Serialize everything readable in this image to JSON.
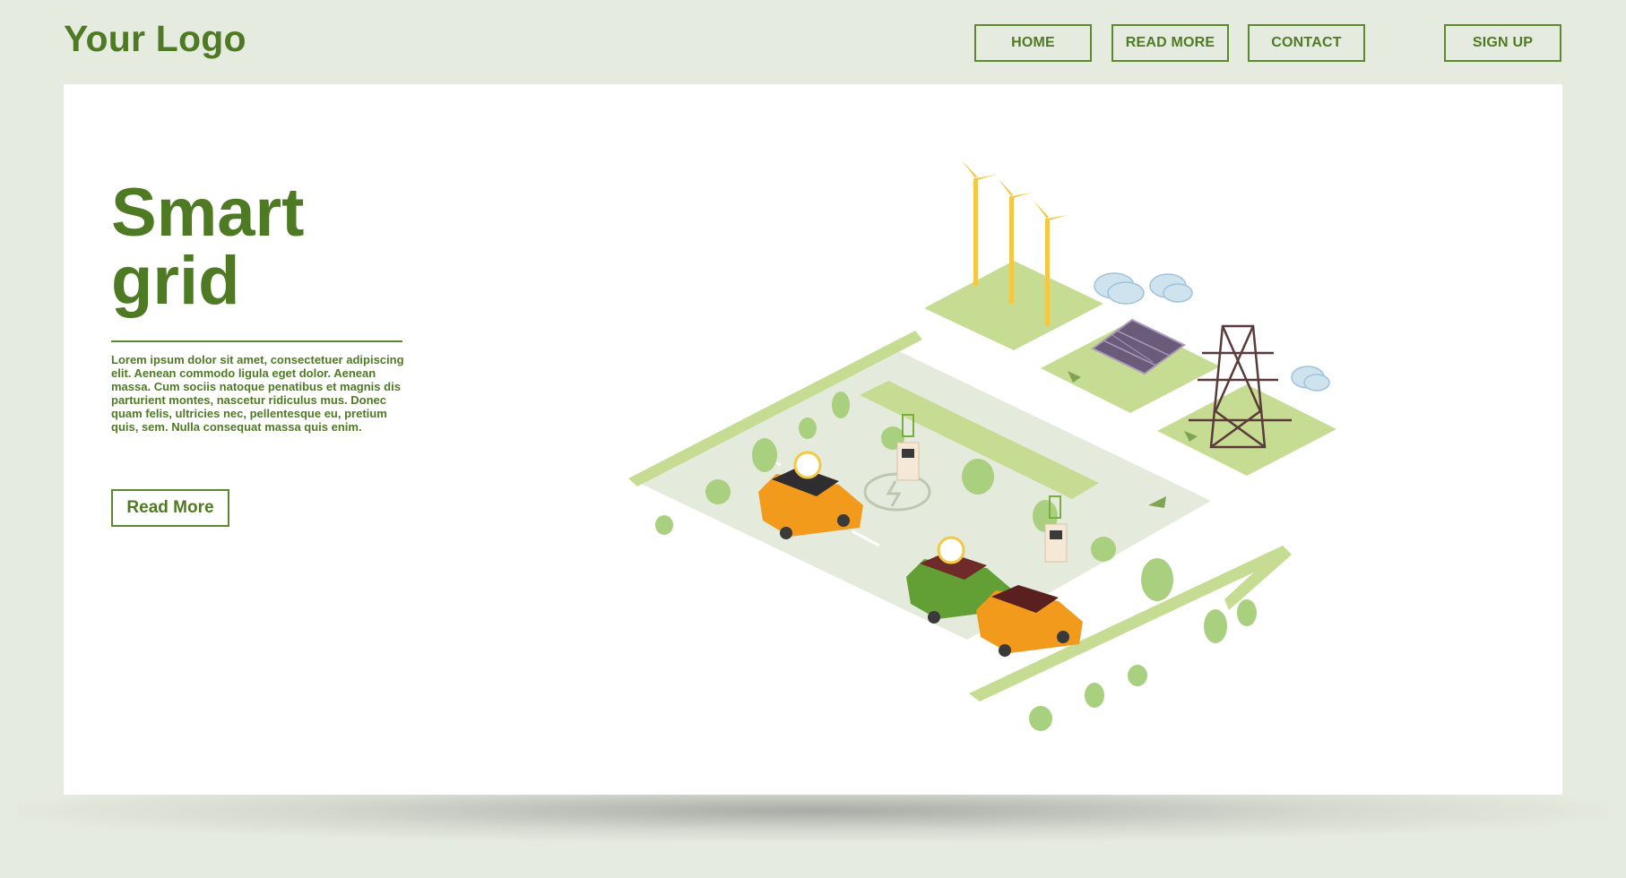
{
  "header": {
    "logo": "Your Logo",
    "nav": {
      "home": "HOME",
      "read_more": "READ MORE",
      "contact": "CONTACT",
      "sign_up": "SIGN UP"
    }
  },
  "hero": {
    "title": "Smart\ngrid",
    "body": "Lorem ipsum dolor sit amet, consectetuer adipiscing elit. Aenean commodo ligula eget dolor. Aenean massa. Cum sociis natoque penatibus et magnis dis parturient montes, nascetur ridiculus mus. Donec quam felis, ultricies nec, pellentesque eu, pretium quis, sem. Nulla consequat massa quis enim.",
    "button": "Read More"
  },
  "colors": {
    "background": "#e6ebdf",
    "accent": "#4f7a24",
    "card": "#ffffff"
  },
  "illustration": {
    "icons": [
      "wind-turbine-icon",
      "solar-panel-icon",
      "power-tower-icon",
      "electric-car-icon",
      "charging-station-icon",
      "tree-icon",
      "cloud-icon"
    ]
  }
}
